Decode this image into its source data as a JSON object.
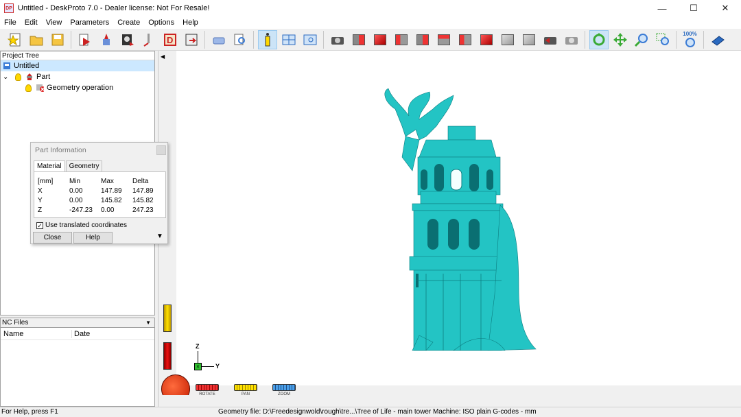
{
  "window": {
    "title": "Untitled - DeskProto 7.0 - Dealer license: Not For Resale!",
    "app_icon_text": "DP",
    "minimize": "—",
    "maximize": "☐",
    "close": "✕"
  },
  "menu": [
    "File",
    "Edit",
    "View",
    "Parameters",
    "Create",
    "Options",
    "Help"
  ],
  "toolbar": {
    "zoom_label": "100%"
  },
  "project_tree": {
    "header": "Project Tree",
    "root": "Untitled",
    "part": "Part",
    "operation": "Geometry operation"
  },
  "nc_files": {
    "header": "NC Files",
    "col_name": "Name",
    "col_date": "Date"
  },
  "part_information": {
    "title": "Part Information",
    "tabs": [
      "Material",
      "Geometry"
    ],
    "unit": "[mm]",
    "headers": [
      "Min",
      "Max",
      "Delta"
    ],
    "rows": [
      {
        "axis": "X",
        "min": "0.00",
        "max": "147.89",
        "delta": "147.89"
      },
      {
        "axis": "Y",
        "min": "0.00",
        "max": "145.82",
        "delta": "145.82"
      },
      {
        "axis": "Z",
        "min": "-247.23",
        "max": "0.00",
        "delta": "247.23"
      }
    ],
    "checkbox_label": "Use translated coordinates",
    "checkbox_checked": true,
    "close_label": "Close",
    "help_label": "Help"
  },
  "viewport": {
    "axis_z": "Z",
    "axis_y": "Y",
    "rotate_label": "ROTATE",
    "pan_label": "PAN",
    "zoom_label": "ZOOM",
    "model_color": "#22c6c6"
  },
  "status": {
    "help": "For Help, press F1",
    "geometry_file": "Geometry file: D:\\Freedesignwold\\rough\\tre...\\Tree of Life - main tower.stl",
    "machine": "Machine: ISO plain G-codes - mm"
  }
}
